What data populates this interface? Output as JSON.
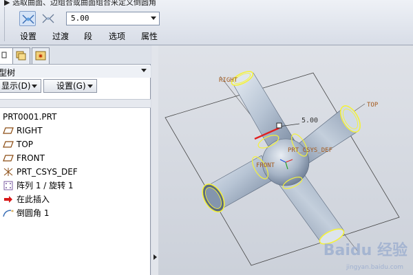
{
  "topbar": {
    "hint": "▶ 选取曲面、边组合或曲面组合来定义倒圆角",
    "radius_value": "5.00",
    "tabs": {
      "settings": "设置",
      "transition": "过渡",
      "segment": "段",
      "options": "选项",
      "properties": "属性"
    }
  },
  "navigator": {
    "tree_title": "型树",
    "show_button": "显示(D)",
    "settings_button": "设置(G)",
    "items": [
      {
        "label": "PRT0001.PRT",
        "icon": "part-icon"
      },
      {
        "label": "RIGHT",
        "icon": "datum-plane-icon"
      },
      {
        "label": "TOP",
        "icon": "datum-plane-icon"
      },
      {
        "label": "FRONT",
        "icon": "datum-plane-icon"
      },
      {
        "label": "PRT_CSYS_DEF",
        "icon": "coordinate-system-icon"
      },
      {
        "label": "阵列 1 / 旋转 1",
        "icon": "pattern-icon"
      },
      {
        "label": "在此插入",
        "icon": "insert-here-arrow-icon"
      },
      {
        "label": "倒圆角 1",
        "icon": "round-feature-icon"
      }
    ]
  },
  "viewport": {
    "labels": {
      "right": "RIGHT",
      "top": "TOP",
      "front": "FRONT",
      "csys": "PRT_CSYS_DEF",
      "dim": "5.00"
    },
    "colors": {
      "tube": "#b9c6d6",
      "tube_shade": "#7d8ea6",
      "edge_highlight": "#f5f23a",
      "datum": "#a45a1c",
      "selected_edge": "#e02020"
    }
  },
  "watermark": {
    "text": "Baidu 经验",
    "url": "jingyan.baidu.com"
  }
}
